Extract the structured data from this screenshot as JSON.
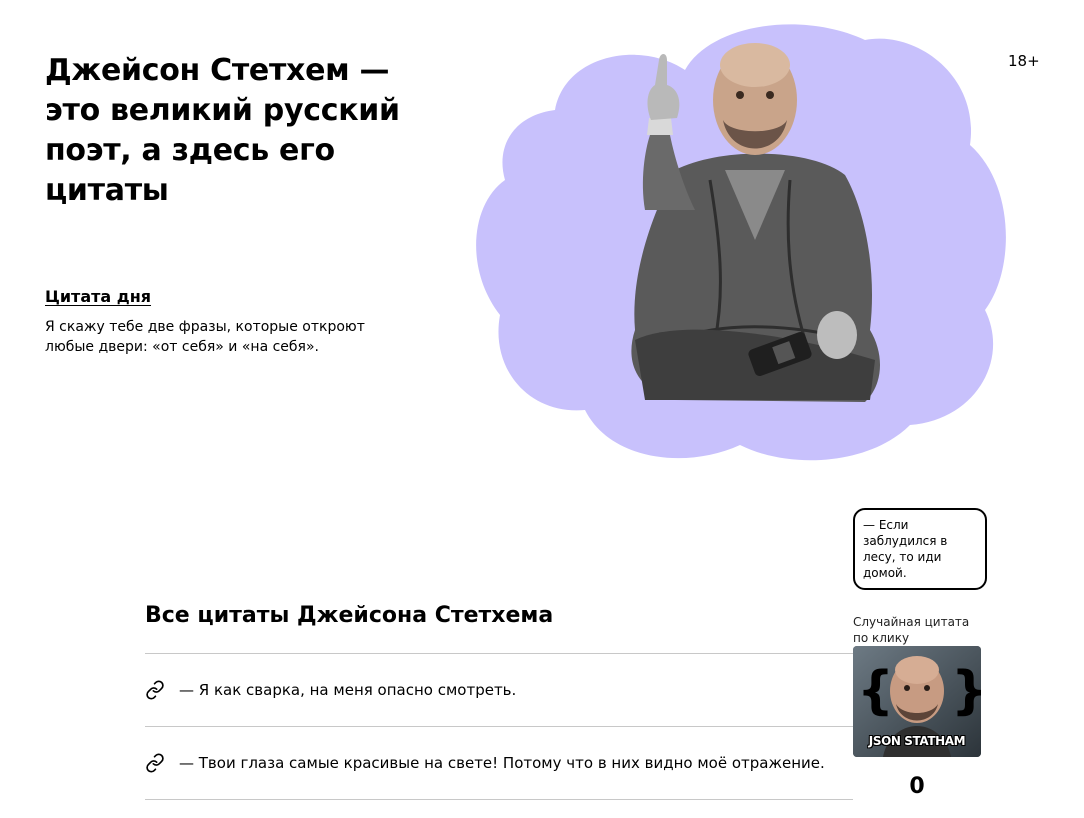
{
  "hero": {
    "title": "Джейсон Стетхем — это великий русский поэт, а здесь его цитаты"
  },
  "age_badge": "18+",
  "quote_of_day": {
    "heading": "Цитата дня",
    "text": "Я скажу тебе две фразы, которые откроют любые двери: «от себя» и «на себя»."
  },
  "random_quote": {
    "bubble_text": "— Если заблудился в лесу, то иди домой.",
    "caption": "Случайная цитата по клику",
    "button_label": "JSON STATHAM",
    "counter": "0"
  },
  "all_quotes": {
    "title": "Все цитаты Джейсона Стетхема",
    "items": [
      {
        "icon": "link-icon",
        "text": "— Я как сварка, на меня опасно смотреть."
      },
      {
        "icon": "link-icon",
        "text": "— Твои глаза самые красивые на свете! Потому что в них видно моё отражение."
      }
    ]
  },
  "colors": {
    "blob": "#c8c1fc",
    "text": "#000000",
    "divider": "#c8c8c8"
  }
}
